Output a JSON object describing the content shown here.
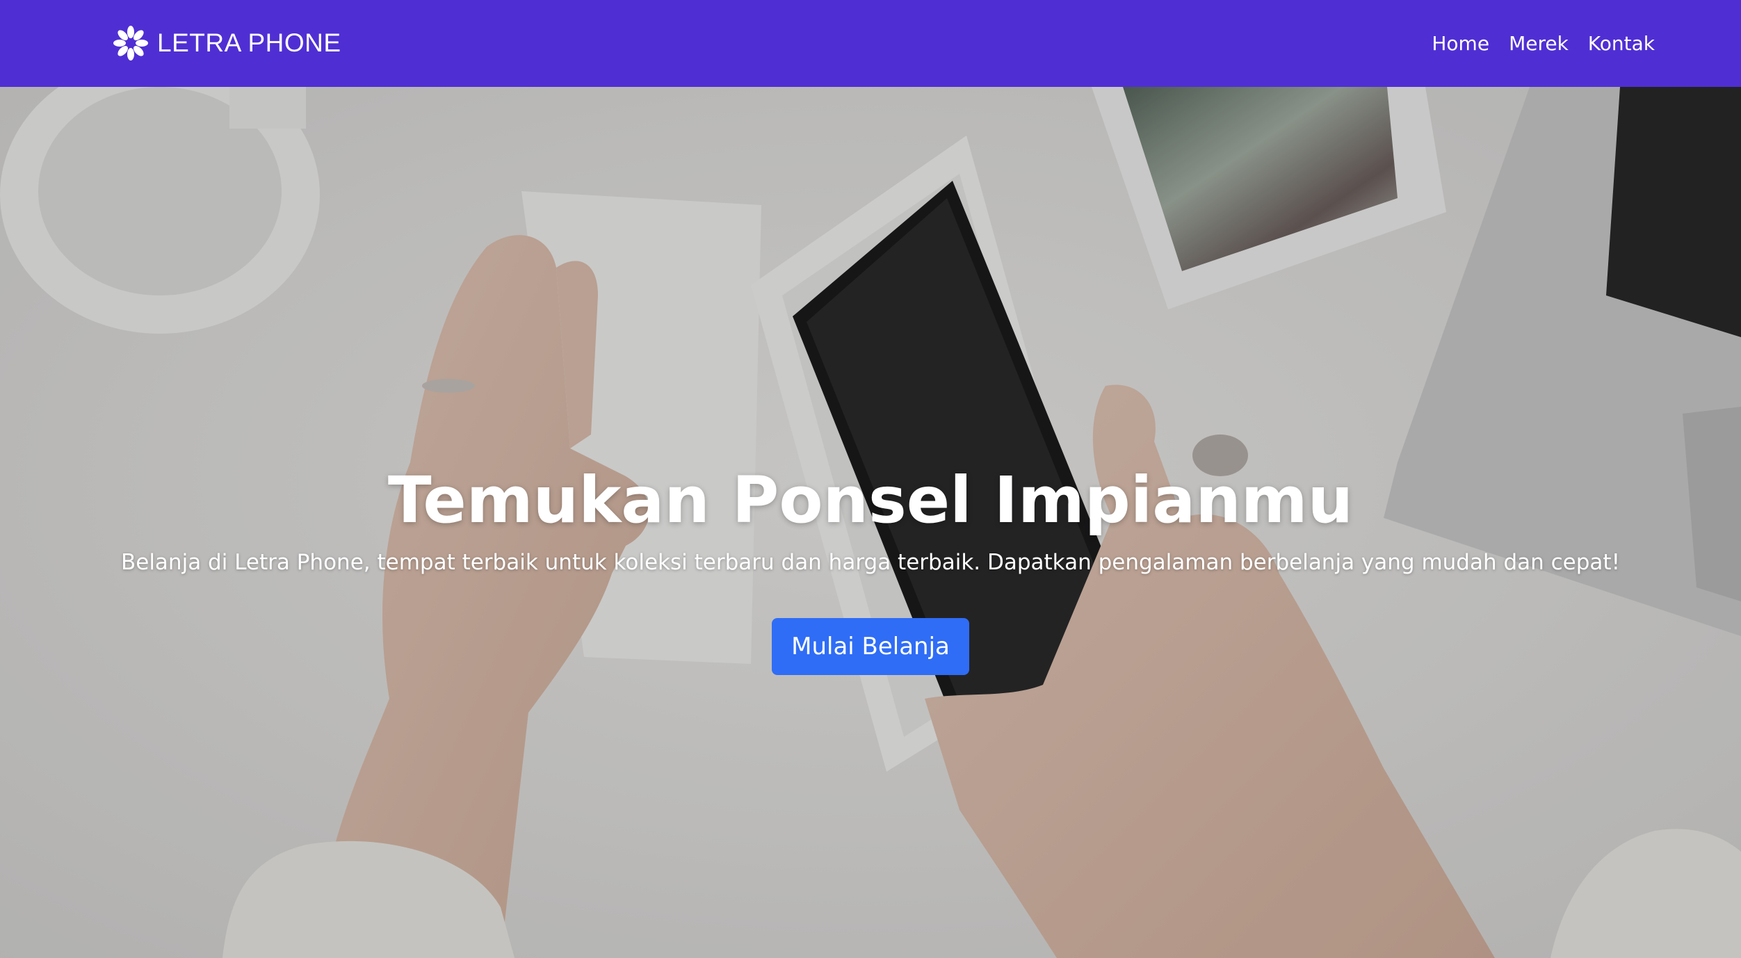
{
  "navbar": {
    "brand_icon": "flower-logo-icon",
    "brand_text": "LETRA PHONE",
    "background_color": "#4f2fd3",
    "links": [
      {
        "label": "Home"
      },
      {
        "label": "Merek"
      },
      {
        "label": "Kontak"
      }
    ]
  },
  "hero": {
    "title": "Temukan Ponsel Impianmu",
    "subtitle": "Belanja di Letra Phone, tempat terbaik untuk koleksi terbaru dan harga terbaik. Dapatkan pengalaman berbelanja yang mudah dan cepat!",
    "cta_label": "Mulai Belanja",
    "cta_color": "#2f6df6"
  }
}
